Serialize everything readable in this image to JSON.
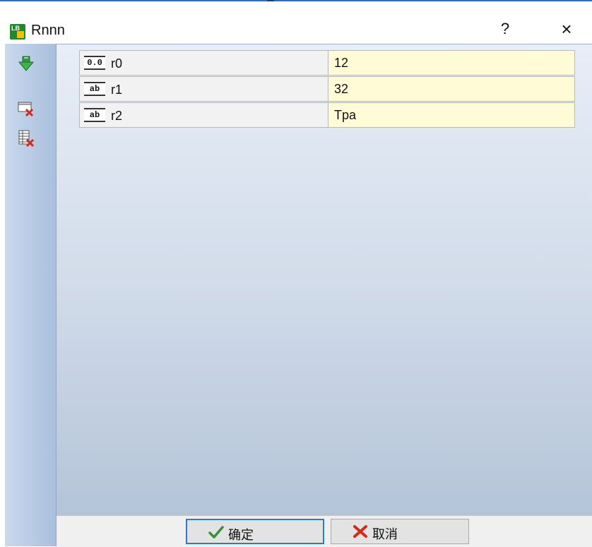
{
  "window": {
    "title": "Rnnn",
    "help_label": "?",
    "close_label": "×"
  },
  "colors": {
    "value_cell_bg": "#fffbd6",
    "ok_border": "#2c7ad6",
    "sidebar_bg": "#b8cbe5"
  },
  "sidebar": {
    "tools": [
      {
        "icon": "down-arrow-icon"
      },
      {
        "icon": "delete-row-icon"
      },
      {
        "icon": "clear-table-icon"
      }
    ]
  },
  "params": [
    {
      "type": "0.0",
      "name": "r0",
      "value": "12"
    },
    {
      "type": "ab",
      "name": "r1",
      "value": "32"
    },
    {
      "type": "ab",
      "name": "r2",
      "value": "Tpa"
    }
  ],
  "buttons": {
    "ok": {
      "label": "确定",
      "icon": "checkmark-icon"
    },
    "cancel": {
      "label": "取消",
      "icon": "red-x-icon"
    }
  }
}
